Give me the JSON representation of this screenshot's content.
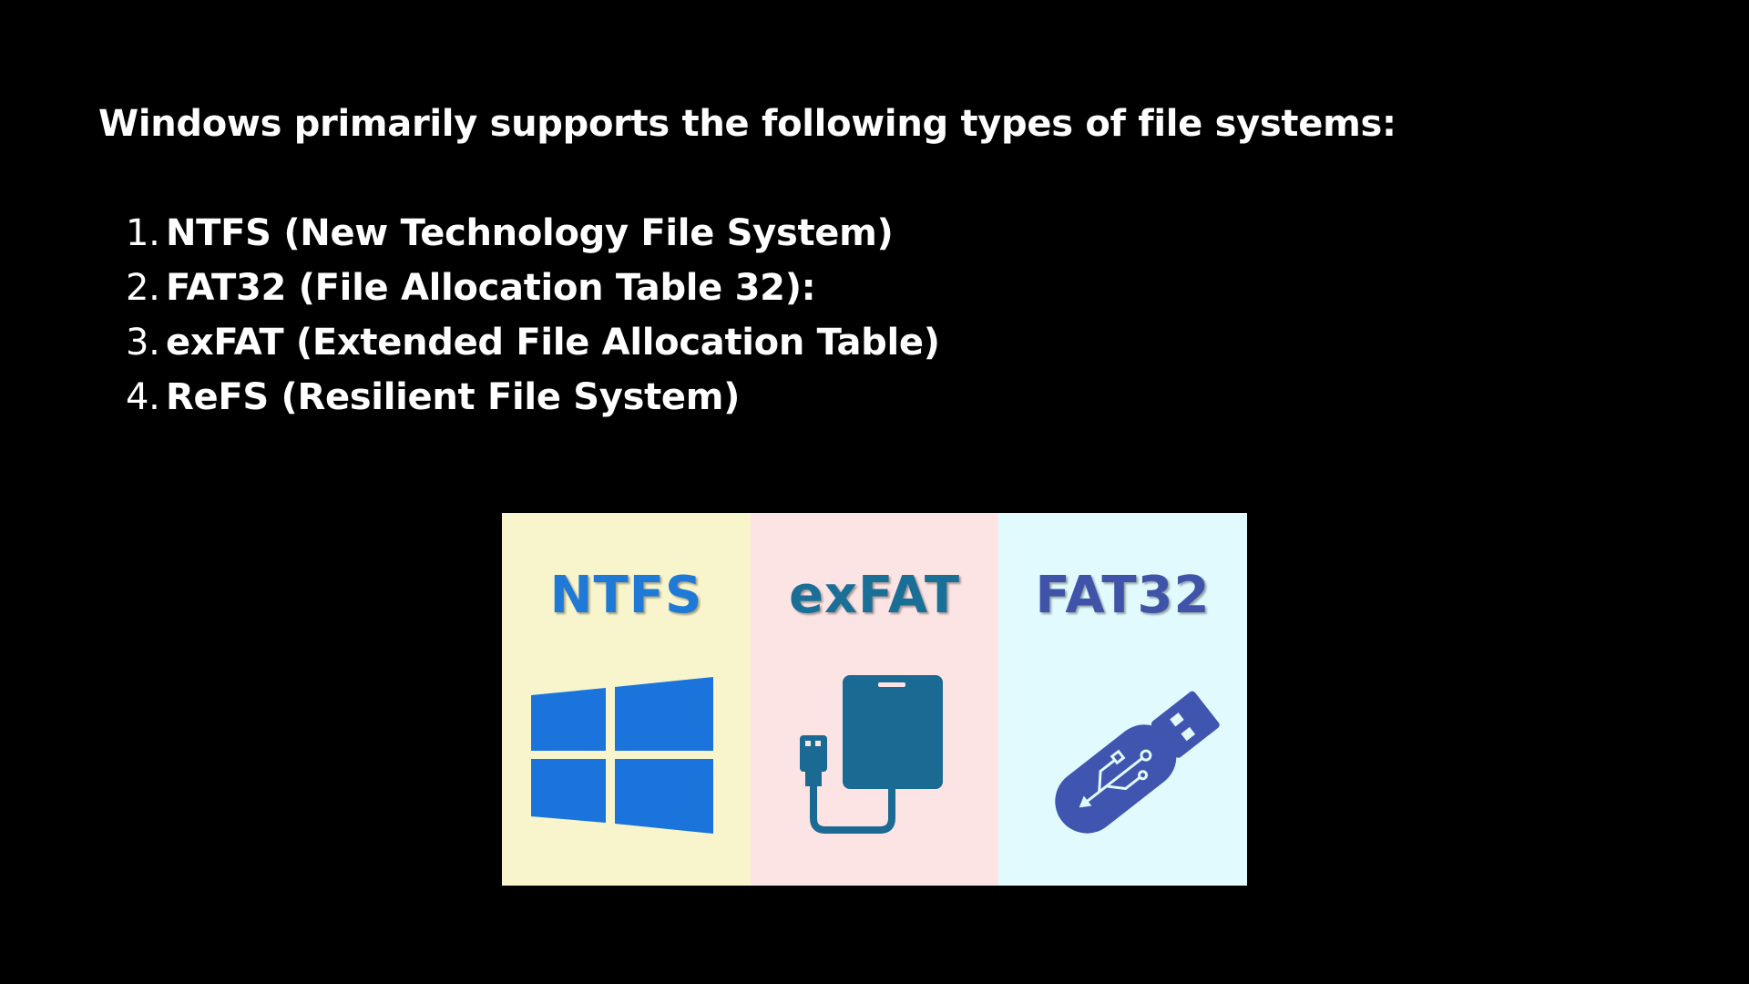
{
  "slide": {
    "heading": "Windows primarily supports the following types of file systems:",
    "list": [
      {
        "number": "1.",
        "name": "NTFS (New Technology File System)"
      },
      {
        "number": "2.",
        "name": "FAT32 (File Allocation Table 32):"
      },
      {
        "number": "3.",
        "name": "exFAT (Extended File Allocation Table)"
      },
      {
        "number": "4.",
        "name": "ReFS (Resilient File System)"
      }
    ]
  },
  "graphic": {
    "columns": [
      {
        "label": "NTFS",
        "icon": "windows-logo-icon",
        "background": "#f8f5cc",
        "label_color": "#1e7ad6"
      },
      {
        "label": "exFAT",
        "icon": "external-drive-icon",
        "background": "#fde4e4",
        "label_color": "#1a6f96"
      },
      {
        "label": "FAT32",
        "icon": "usb-flash-drive-icon",
        "background": "#e0fafd",
        "label_color": "#3f53a9"
      }
    ]
  }
}
